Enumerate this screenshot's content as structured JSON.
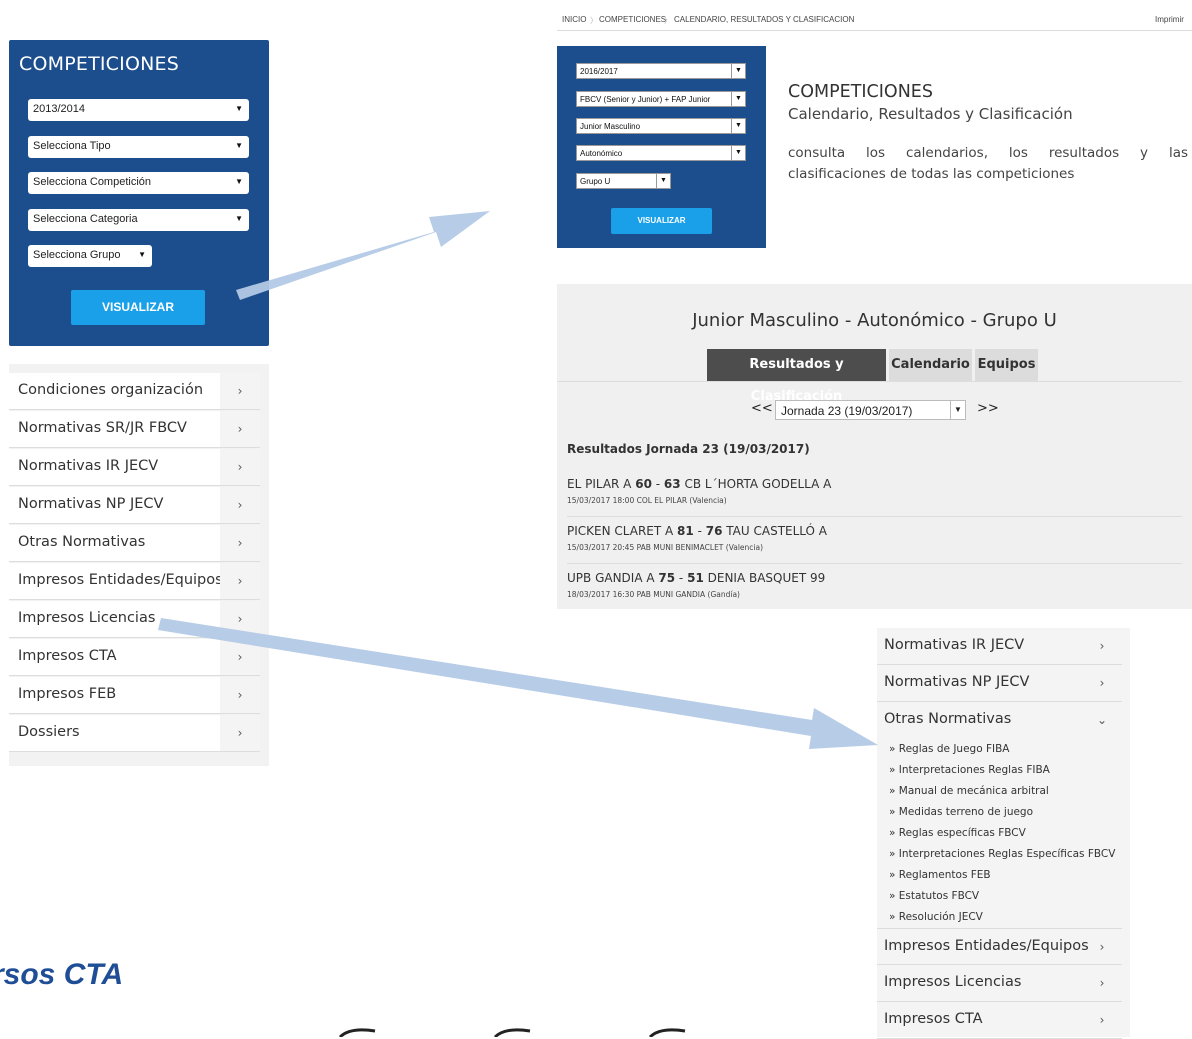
{
  "left_panel": {
    "title": "COMPETICIONES",
    "selects": [
      "2013/2014",
      "Selecciona Tipo",
      "Selecciona Competición",
      "Selecciona Categoria",
      "Selecciona Grupo"
    ],
    "button": "VISUALIZAR"
  },
  "left_menu": {
    "items": [
      {
        "label": "Condiciones organización"
      },
      {
        "label": "Normativas SR/JR FBCV"
      },
      {
        "label": "Normativas IR JECV"
      },
      {
        "label": "Normativas NP JECV"
      },
      {
        "label": "Otras Normativas"
      },
      {
        "label": "Impresos Entidades/Equipos"
      },
      {
        "label": "Impresos Licencias"
      },
      {
        "label": "Impresos CTA"
      },
      {
        "label": "Impresos FEB"
      },
      {
        "label": "Dossiers"
      }
    ],
    "arrow": "›"
  },
  "breadcrumb": {
    "items": [
      "INICIO",
      "COMPETICIONES",
      "CALENDARIO, RESULTADOS Y CLASIFICACION"
    ],
    "print": "Imprimir"
  },
  "right_panel": {
    "selects": [
      "2016/2017",
      "FBCV (Senior y Junior) + FAP Junior",
      "Junior Masculino",
      "Autonómico",
      "Grupo U"
    ],
    "button": "VISUALIZAR"
  },
  "header": {
    "title": "COMPETICIONES",
    "subtitle": "Calendario, Resultados y Clasificación",
    "description": "consulta los calendarios, los resultados y las clasificaciones de todas las competiciones"
  },
  "results": {
    "heading": "Junior Masculino - Autonómico - Grupo U",
    "tabs": [
      "Resultados y Clasificación",
      "Calendario",
      "Equipos"
    ],
    "prev": "<<",
    "next": ">>",
    "jornada_select": "Jornada 23 (19/03/2017)",
    "section_title": "Resultados Jornada 23 (19/03/2017)",
    "matches": [
      {
        "home": "EL PILAR A",
        "home_score": "60",
        "sep": "-",
        "away_score": "63",
        "away": "CB L´HORTA GODELLA A",
        "detail": "15/03/2017 18:00 COL EL PILAR (Valencia)"
      },
      {
        "home": "PICKEN CLARET A",
        "home_score": "81",
        "sep": "-",
        "away_score": "76",
        "away": "TAU CASTELLÓ A",
        "detail": "15/03/2017 20:45 PAB MUNI BENIMACLET (Valencia)"
      },
      {
        "home": "UPB GANDIA A",
        "home_score": "75",
        "sep": "-",
        "away_score": "51",
        "away": "DENIA BASQUET 99",
        "detail": "18/03/2017 16:30 PAB MUNI GANDIA (Gandía)"
      }
    ]
  },
  "bottom_menu": {
    "items_top": [
      {
        "label": "Normativas IR JECV",
        "arrow": "›"
      },
      {
        "label": "Normativas NP JECV",
        "arrow": "›"
      },
      {
        "label": "Otras Normativas",
        "arrow": "⌄"
      }
    ],
    "subitems": [
      "» Reglas de Juego FIBA",
      "» Interpretaciones Reglas FIBA",
      "» Manual de mecánica arbitral",
      "» Medidas terreno de juego",
      "» Reglas específicas FBCV",
      "» Interpretaciones Reglas Específicas FBCV",
      "» Reglamentos FEB",
      "» Estatutos FBCV",
      "» Resolución JECV"
    ],
    "items_bottom": [
      {
        "label": "Impresos Entidades/Equipos",
        "arrow": "›"
      },
      {
        "label": "Impresos Licencias",
        "arrow": "›"
      },
      {
        "label": "Impresos CTA",
        "arrow": "›"
      }
    ]
  },
  "footer_heading": "rsos CTA",
  "colors": {
    "panel_blue": "#1c4d8c",
    "button_blue": "#1aa0e8",
    "arrow_blue": "#b3c9e6",
    "tab_active": "#4d4d4d"
  }
}
